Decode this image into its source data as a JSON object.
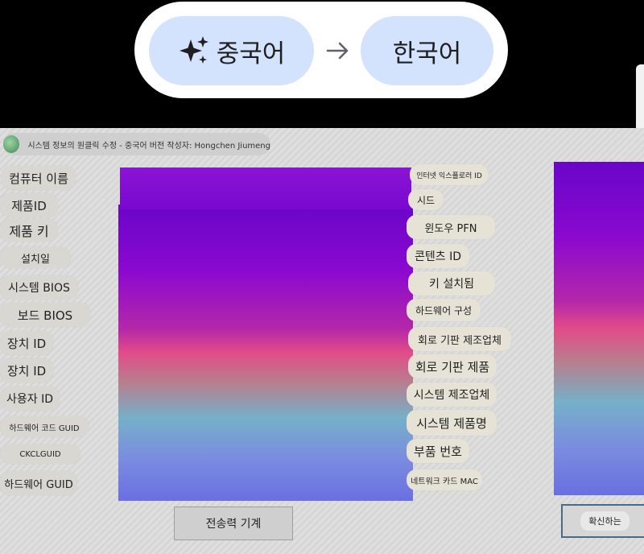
{
  "translate_bar": {
    "source_language": "중국어",
    "target_language": "한국어",
    "sparkle_icon": "sparkle-icon",
    "arrow_icon": "arrow-right-icon"
  },
  "window": {
    "title": "시스템 정보의 원클릭 수정 - 중국어 버전 작성자: Hongchen Jiumeng"
  },
  "left_labels": [
    "컴퓨터 이름",
    "제품ID",
    "제품 키",
    "설치일",
    "시스템 BIOS",
    "보드 BIOS",
    "장치 ID",
    "장치 ID",
    "사용자 ID",
    "하드웨어 코드 GUID",
    "CKCLGUID",
    "하드웨어 GUID"
  ],
  "right_labels": [
    "인터넷 익스플로러 ID",
    "시드",
    "윈도우 PFN",
    "콘텐츠 ID",
    "키 설치됨",
    "하드웨어 구성",
    "회로 기판 제조업체",
    "회로 기판 제품",
    "시스템 제조업체",
    "시스템 제품명",
    "부품 번호",
    "네트워크 카드 MAC"
  ],
  "buttons": {
    "transfer": "전송력 기계",
    "confirm": "확신하는"
  },
  "colors": {
    "translate_chip": "#d3e3fd",
    "panel_gradient_top": "#7a08d0",
    "panel_gradient_mid": "#e24c88",
    "panel_gradient_bottom": "#6a6fe0"
  }
}
